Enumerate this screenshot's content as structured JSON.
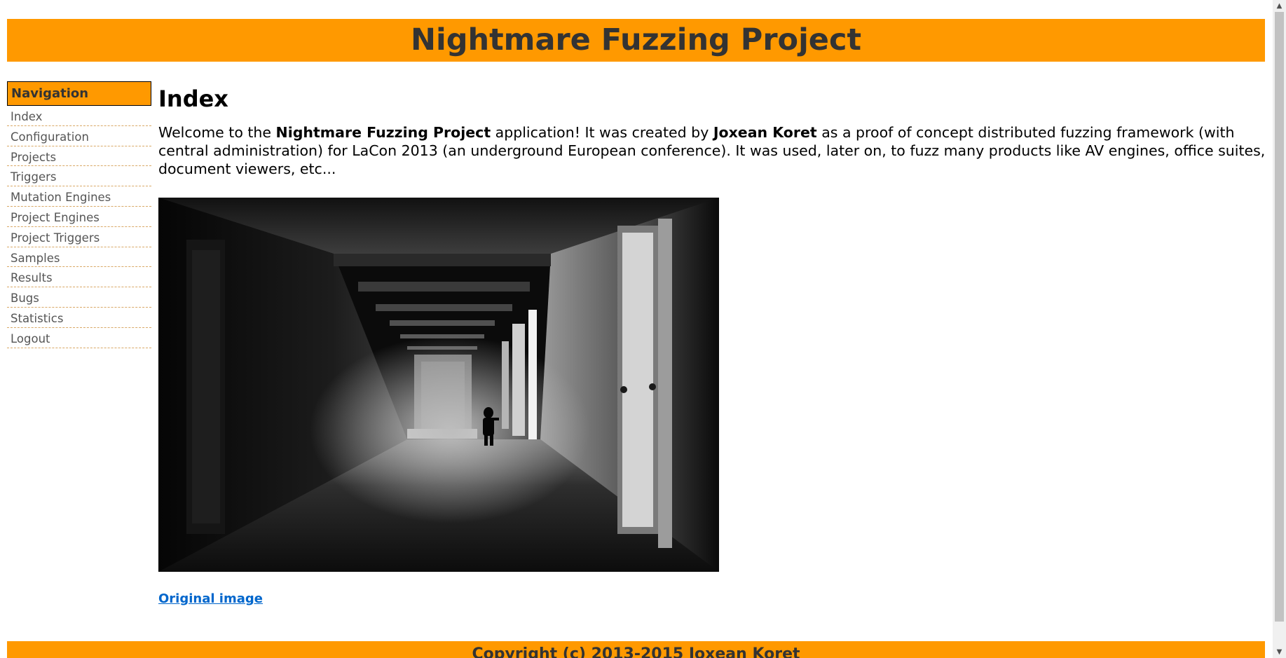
{
  "header": {
    "title": "Nightmare Fuzzing Project"
  },
  "nav": {
    "title": "Navigation",
    "items": [
      "Index",
      "Configuration",
      "Projects",
      "Triggers",
      "Mutation Engines",
      "Project Engines",
      "Project Triggers",
      "Samples",
      "Results",
      "Bugs",
      "Statistics",
      "Logout"
    ]
  },
  "content": {
    "heading": "Index",
    "intro": {
      "p1": "Welcome to the ",
      "project": "Nightmare Fuzzing Project",
      "p2": " application! It was created by ",
      "author": "Joxean Koret",
      "p3": " as a proof of concept distributed fuzzing framework (with central administration) for LaCon 2013 (an underground European conference). It was used, later on, to fuzz many products like AV engines, office suites, document viewers, etc..."
    },
    "link_label": "Original image"
  },
  "footer": {
    "text": "Copyright (c) 2013-2015 Joxean Koret"
  },
  "colors": {
    "accent": "#ff9900",
    "link": "#0066cc",
    "nav_text": "#555555"
  }
}
